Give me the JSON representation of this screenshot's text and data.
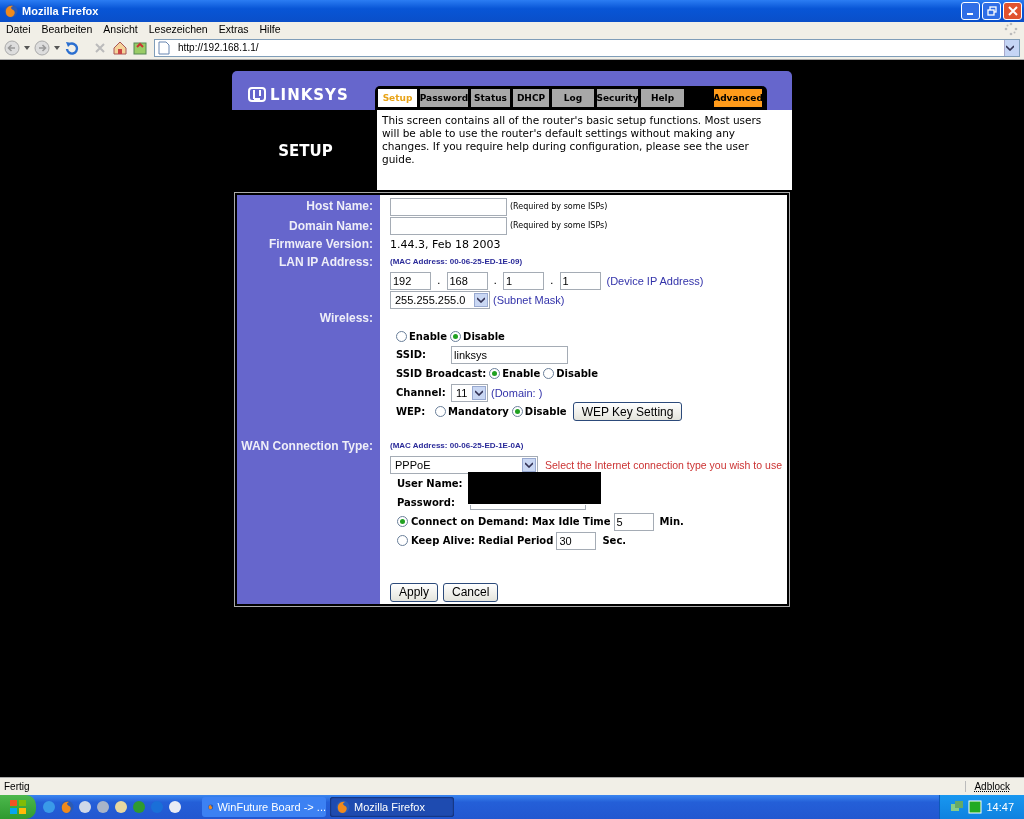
{
  "window": {
    "title": "Mozilla Firefox"
  },
  "menu": [
    "Datei",
    "Bearbeiten",
    "Ansicht",
    "Lesezeichen",
    "Extras",
    "Hilfe"
  ],
  "address": "http://192.168.1.1/",
  "router": {
    "logo": "LINKSYS",
    "tabs": [
      {
        "label": "Setup",
        "selected": true,
        "kind": "normal"
      },
      {
        "label": "Password",
        "selected": false,
        "kind": "normal"
      },
      {
        "label": "Status",
        "selected": false,
        "kind": "normal"
      },
      {
        "label": "DHCP",
        "selected": false,
        "kind": "normal"
      },
      {
        "label": "Log",
        "selected": false,
        "kind": "normal"
      },
      {
        "label": "Security",
        "selected": false,
        "kind": "normal"
      },
      {
        "label": "Help",
        "selected": false,
        "kind": "normal"
      },
      {
        "label": "Advanced",
        "selected": false,
        "kind": "advanced"
      }
    ],
    "page_title": "SETUP",
    "description": "This screen contains all of the router's basic setup functions. Most users will be able to use the router's default settings without making any changes. If you require help during configuration, please see the user guide.",
    "host_name": {
      "label": "Host Name:",
      "note": "(Required by some ISPs)"
    },
    "domain_name": {
      "label": "Domain Name:",
      "note": "(Required by some ISPs)"
    },
    "firmware": {
      "label": "Firmware Version:",
      "value": "1.44.3, Feb 18 2003"
    },
    "lan": {
      "label": "LAN IP Address:",
      "mac": "(MAC Address: 00-06-25-ED-1E-09)",
      "ip": [
        "192",
        "168",
        "1",
        "1"
      ],
      "ip_separators": [
        ".",
        ".",
        "."
      ],
      "ip_note": "(Device IP Address)",
      "subnet": "255.255.255.0",
      "subnet_note": "(Subnet Mask)"
    },
    "wireless": {
      "label": "Wireless:",
      "options": [
        {
          "label": "Enable",
          "selected": false
        },
        {
          "label": "Disable",
          "selected": true
        }
      ],
      "ssid_label": "SSID:",
      "ssid": "linksys",
      "broadcast_label": "SSID Broadcast:",
      "broadcast_options": [
        {
          "label": "Enable",
          "selected": true
        },
        {
          "label": "Disable",
          "selected": false
        }
      ],
      "channel_label": "Channel:",
      "channel": "11",
      "domain_note": "(Domain: )",
      "wep_label": "WEP:",
      "wep_options": [
        {
          "label": "Mandatory",
          "selected": false
        },
        {
          "label": "Disable",
          "selected": true
        }
      ],
      "wep_button": "WEP Key Setting"
    },
    "wan": {
      "label": "WAN Connection Type:",
      "mac": "(MAC Address: 00-06-25-ED-1E-0A)",
      "type": "PPPoE",
      "hint": "Select the Internet connection type you wish to use",
      "user_label": "User Name:",
      "password_label": "Password:",
      "modes": [
        {
          "label": "Connect on Demand: Max Idle Time",
          "value": "5",
          "unit": "Min.",
          "selected": true
        },
        {
          "label": "Keep Alive: Redial Period",
          "value": "30",
          "unit": "Sec.",
          "selected": false
        }
      ]
    },
    "buttons": [
      "Apply",
      "Cancel"
    ]
  },
  "status": {
    "text": "Fertig",
    "adblock": "Adblock"
  },
  "taskbar": {
    "tasks": [
      {
        "label": "WinFuture Board -> ...",
        "selected": false
      },
      {
        "label": "Mozilla Firefox",
        "selected": true
      }
    ],
    "clock": "14:47"
  }
}
